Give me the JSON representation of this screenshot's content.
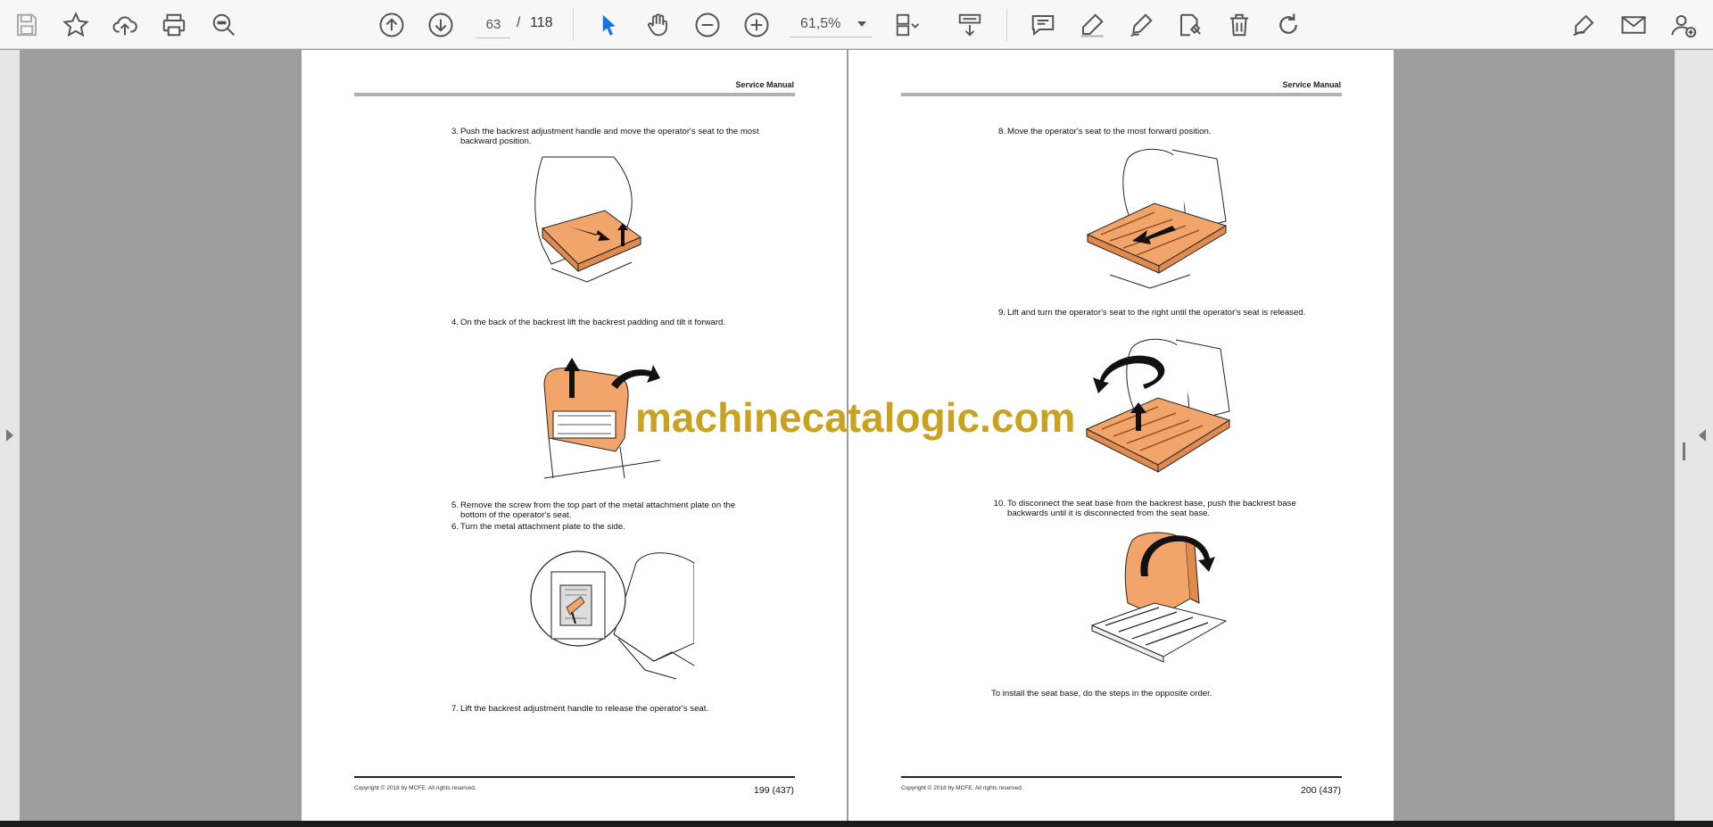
{
  "toolbar": {
    "icons_left": [
      "save-icon",
      "star-icon",
      "cloud-upload-icon",
      "print-icon",
      "zoom-search-icon"
    ],
    "page_current": "63",
    "page_separator": "/",
    "page_total": "118",
    "zoom": "61,5%",
    "icons_right": [
      "comment-icon",
      "highlight-pen-icon",
      "sign-pen-icon",
      "stamp-icon",
      "delete-icon",
      "rotate-icon",
      "fill-sign-icon",
      "email-icon",
      "add-user-icon"
    ]
  },
  "watermark": "machinecatalogic.com",
  "left_page": {
    "header": "Service Manual",
    "steps": [
      {
        "num": "3.",
        "text": "Push the backrest adjustment handle and move the operator's seat to the most backward position."
      },
      {
        "num": "4.",
        "text": "On the back of the backrest lift the backrest padding and tilt it forward."
      },
      {
        "num": "5.",
        "text": "Remove the screw from the top part of the metal attachment plate on the bottom of the operator's seat."
      },
      {
        "num": "6.",
        "text": "Turn the metal attachment plate to the side."
      },
      {
        "num": "7.",
        "text": "Lift the backrest adjustment handle to release the operator's seat."
      }
    ],
    "copyright": "Copyright © 2018 by MCFE. All rights reserved.",
    "page_number": "199 (437)"
  },
  "right_page": {
    "header": "Service Manual",
    "steps": [
      {
        "num": "8.",
        "text": "Move the operator's seat to the most forward position."
      },
      {
        "num": "9.",
        "text": "Lift and turn the operator's seat to the right until the operator's seat is released."
      },
      {
        "num": "10.",
        "text": "To disconnect the seat base from the backrest base, push the backrest base backwards until it is disconnected from the seat base."
      }
    ],
    "closing": "To install the seat base, do the steps in the opposite order.",
    "copyright": "Copyright © 2018 by MCFE. All rights reserved.",
    "page_number": "200 (437)"
  },
  "colors": {
    "illustration_orange": "#f2a56a",
    "toolbar_blue": "#1473e6",
    "watermark": "#c9a320"
  }
}
